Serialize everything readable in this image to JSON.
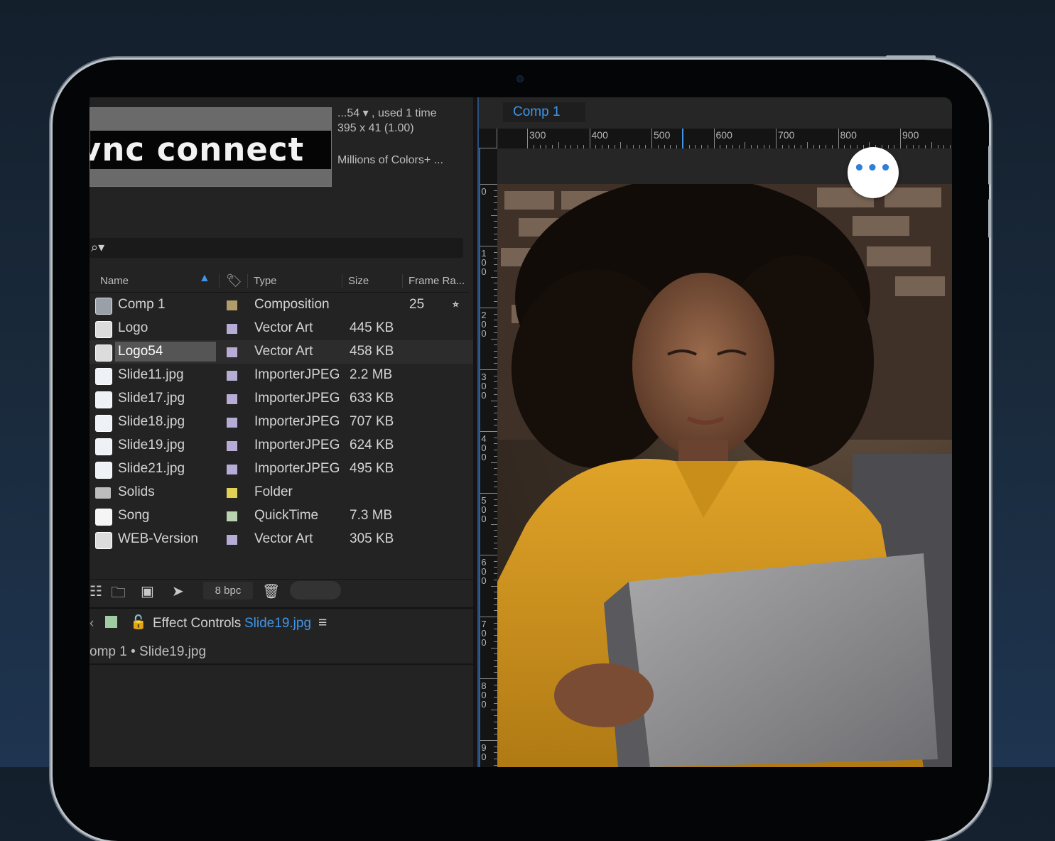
{
  "asset_info": {
    "name_line": "...54 ▾ , used 1 time",
    "dimensions": "395 x 41 (1.00)",
    "colors": "Millions of Colors+ ..."
  },
  "thumbnail": {
    "logo_text": "vnc connect"
  },
  "search": {
    "icon": "search-icon"
  },
  "columns": {
    "name": "Name",
    "type": "Type",
    "size": "Size",
    "frame_rate": "Frame Ra..."
  },
  "items": [
    {
      "name": "Comp 1",
      "icon": "composition-icon",
      "label_color": "#b39c6c",
      "type": "Composition",
      "size": "",
      "frame_rate": "25",
      "flowchart": "⭒"
    },
    {
      "name": "Logo",
      "icon": "vector-file-icon",
      "label_color": "#b6acd6",
      "type": "Vector Art",
      "size": "445 KB",
      "frame_rate": ""
    },
    {
      "name": "Logo54",
      "icon": "vector-file-icon",
      "label_color": "#b6acd6",
      "type": "Vector Art",
      "size": "458 KB",
      "frame_rate": ""
    },
    {
      "name": "Slide11.jpg",
      "icon": "jpeg-file-icon",
      "label_color": "#b6acd6",
      "type": "ImporterJPEG",
      "size": "2.2 MB",
      "frame_rate": ""
    },
    {
      "name": "Slide17.jpg",
      "icon": "jpeg-file-icon",
      "label_color": "#b6acd6",
      "type": "ImporterJPEG",
      "size": "633 KB",
      "frame_rate": ""
    },
    {
      "name": "Slide18.jpg",
      "icon": "jpeg-file-icon",
      "label_color": "#b6acd6",
      "type": "ImporterJPEG",
      "size": "707 KB",
      "frame_rate": ""
    },
    {
      "name": "Slide19.jpg",
      "icon": "jpeg-file-icon",
      "label_color": "#b6acd6",
      "type": "ImporterJPEG",
      "size": "624 KB",
      "frame_rate": ""
    },
    {
      "name": "Slide21.jpg",
      "icon": "jpeg-file-icon",
      "label_color": "#b6acd6",
      "type": "ImporterJPEG",
      "size": "495 KB",
      "frame_rate": ""
    },
    {
      "name": "Solids",
      "icon": "folder-icon",
      "label_color": "#e2cf55",
      "type": "Folder",
      "size": "",
      "frame_rate": ""
    },
    {
      "name": "Song",
      "icon": "quicktime-file-icon",
      "label_color": "#b9d2b0",
      "type": "QuickTime",
      "size": "7.3 MB",
      "frame_rate": ""
    },
    {
      "name": "WEB-Version",
      "icon": "vector-file-icon",
      "label_color": "#b6acd6",
      "type": "Vector Art",
      "size": "305 KB",
      "frame_rate": ""
    }
  ],
  "selected_item": "Logo54",
  "footer": {
    "bpc": "8 bpc"
  },
  "effect_controls": {
    "title": "Effect Controls",
    "layer": "Slide19.jpg",
    "breadcrumb": "omp 1 • Slide19.jpg",
    "label_color": "#9fcca0"
  },
  "composition": {
    "tab_label": "Comp 1",
    "ruler_h": [
      "300",
      "400",
      "500",
      "600",
      "700",
      "800",
      "900"
    ],
    "ruler_v": [
      "0",
      "1\n0\n0",
      "2\n0\n0",
      "3\n0\n0",
      "4\n0\n0",
      "5\n0\n0",
      "6\n0\n0",
      "7\n0\n0",
      "8\n0\n0",
      "9\n0"
    ]
  },
  "overlay": {
    "more_label": "•••"
  },
  "accent_color": "#3f95e8"
}
